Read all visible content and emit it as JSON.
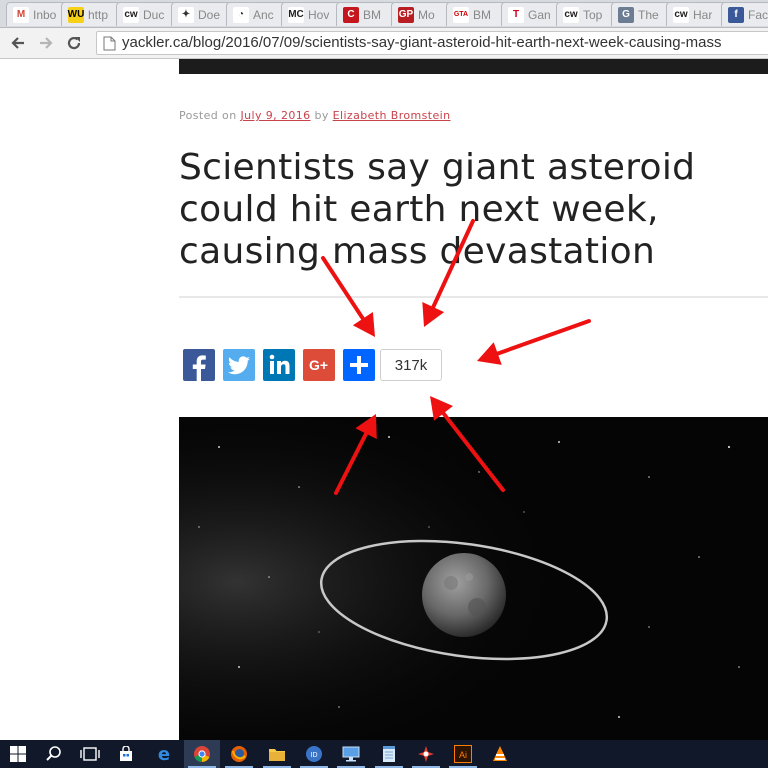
{
  "browser": {
    "tabs": [
      {
        "label": "Inbo",
        "icon": "gmail-icon",
        "glyph": "M",
        "color": "#d44638",
        "bg": "#ffffff"
      },
      {
        "label": "http",
        "icon": "wu-icon",
        "glyph": "WU",
        "color": "#000000",
        "bg": "#f7d117"
      },
      {
        "label": "Duc",
        "icon": "cw-icon",
        "glyph": "cw",
        "color": "#222222",
        "bg": "#ffffff"
      },
      {
        "label": "Doe",
        "icon": "ghost-icon",
        "glyph": "✦",
        "color": "#333333",
        "bg": "#ffffff"
      },
      {
        "label": "Anc",
        "icon": "circle-logo-icon",
        "glyph": "◔",
        "color": "#333333",
        "bg": "#ffffff"
      },
      {
        "label": "Hov",
        "icon": "mc-icon",
        "glyph": "MC",
        "color": "#222222",
        "bg": "#ffffff"
      },
      {
        "label": "BM",
        "icon": "c-logo-icon",
        "glyph": "C",
        "color": "#ffffff",
        "bg": "#c4161c"
      },
      {
        "label": "Mo",
        "icon": "gp-icon",
        "glyph": "GP",
        "color": "#ffffff",
        "bg": "#b81d24"
      },
      {
        "label": "BM",
        "icon": "gta-icon",
        "glyph": "GTA",
        "color": "#d00000",
        "bg": "#ffffff"
      },
      {
        "label": "Gan",
        "icon": "t-logo-icon",
        "glyph": "T",
        "color": "#d0021b",
        "bg": "#ffffff"
      },
      {
        "label": "Top",
        "icon": "cw-icon",
        "glyph": "cw",
        "color": "#222222",
        "bg": "#ffffff"
      },
      {
        "label": "The",
        "icon": "g-logo-icon",
        "glyph": "G",
        "color": "#ffffff",
        "bg": "#6b7c93"
      },
      {
        "label": "Har",
        "icon": "cw-icon",
        "glyph": "cw",
        "color": "#222222",
        "bg": "#ffffff"
      },
      {
        "label": "Fac",
        "icon": "facebook-icon",
        "glyph": "f",
        "color": "#ffffff",
        "bg": "#3b5998"
      }
    ],
    "nav": {
      "back": "←",
      "forward": "→",
      "reload": "↻"
    },
    "url": "yackler.ca/blog/2016/07/09/scientists-say-giant-asteroid-hit-earth-next-week-causing-mass"
  },
  "article": {
    "posted_on_label": "Posted on",
    "date": "July 9, 2016",
    "by_label": "by",
    "author": "Elizabeth Bromstein",
    "title": "Scientists say giant asteroid could hit earth next week, causing mass devastation",
    "share": {
      "buttons": [
        {
          "name": "facebook-share-button",
          "icon": "facebook-icon",
          "glyph": "f",
          "color": "#3b5998"
        },
        {
          "name": "twitter-share-button",
          "icon": "twitter-icon",
          "glyph": "🐦",
          "color": "#55acee"
        },
        {
          "name": "linkedin-share-button",
          "icon": "linkedin-icon",
          "glyph": "in",
          "color": "#0077b5"
        },
        {
          "name": "googleplus-share-button",
          "icon": "googleplus-icon",
          "glyph": "G+",
          "color": "#dd4b39"
        },
        {
          "name": "more-share-button",
          "icon": "plus-icon",
          "glyph": "+",
          "color": "#0166ff"
        }
      ],
      "count": "317k"
    }
  },
  "annotation": {
    "arrow_color": "#ee1111"
  },
  "taskbar": {
    "items": [
      {
        "name": "start-button",
        "icon": "windows-icon"
      },
      {
        "name": "search-button",
        "icon": "search-icon"
      },
      {
        "name": "task-view-button",
        "icon": "task-view-icon"
      },
      {
        "name": "store-button",
        "icon": "store-icon"
      },
      {
        "name": "edge-button",
        "icon": "edge-icon"
      },
      {
        "name": "chrome-button",
        "icon": "chrome-icon"
      },
      {
        "name": "firefox-button",
        "icon": "firefox-icon"
      },
      {
        "name": "file-explorer-button",
        "icon": "folder-icon"
      },
      {
        "name": "app-button",
        "icon": "app-icon"
      },
      {
        "name": "remote-desktop-button",
        "icon": "monitor-icon"
      },
      {
        "name": "notepad-button",
        "icon": "notepad-icon"
      },
      {
        "name": "paint-button",
        "icon": "paint-icon"
      },
      {
        "name": "illustrator-button",
        "icon": "illustrator-icon"
      },
      {
        "name": "vlc-button",
        "icon": "vlc-icon"
      }
    ]
  }
}
